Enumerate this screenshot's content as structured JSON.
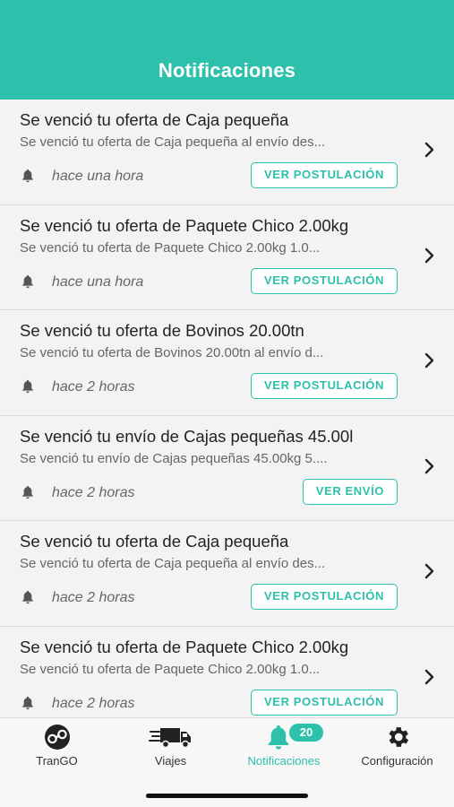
{
  "header": {
    "title": "Notificaciones"
  },
  "colors": {
    "accent": "#2dc0aa",
    "background": "#f3f3f3"
  },
  "notifications": [
    {
      "title": "Se venció tu oferta de Caja pequeña",
      "description": "Se venció tu oferta de Caja pequeña al envío des...",
      "time": "hace una hora",
      "action": "VER POSTULACIÓN"
    },
    {
      "title": "Se venció tu oferta de Paquete Chico 2.00kg",
      "description": "Se venció tu oferta de Paquete Chico 2.00kg 1.0...",
      "time": "hace una hora",
      "action": "VER POSTULACIÓN"
    },
    {
      "title": "Se venció tu oferta de Bovinos 20.00tn",
      "description": "Se venció tu oferta de Bovinos 20.00tn al envío d...",
      "time": "hace 2 horas",
      "action": "VER POSTULACIÓN"
    },
    {
      "title": "Se venció tu envío de Cajas pequeñas 45.00l",
      "description": "Se venció tu envío de Cajas pequeñas 45.00kg 5....",
      "time": "hace 2 horas",
      "action": "VER ENVÍO"
    },
    {
      "title": "Se venció tu oferta de Caja pequeña",
      "description": "Se venció tu oferta de Caja pequeña al envío des...",
      "time": "hace 2 horas",
      "action": "VER POSTULACIÓN"
    },
    {
      "title": "Se venció tu oferta de Paquete Chico 2.00kg",
      "description": "Se venció tu oferta de Paquete Chico 2.00kg 1.0...",
      "time": "hace 2 horas",
      "action": "VER POSTULACIÓN"
    }
  ],
  "tabbar": {
    "items": [
      {
        "label": "TranGO",
        "icon": "trango-logo-icon"
      },
      {
        "label": "Viajes",
        "icon": "truck-icon"
      },
      {
        "label": "Notificaciones",
        "icon": "bell-icon",
        "badge": "20",
        "active": true
      },
      {
        "label": "Configuración",
        "icon": "gear-icon"
      }
    ]
  }
}
